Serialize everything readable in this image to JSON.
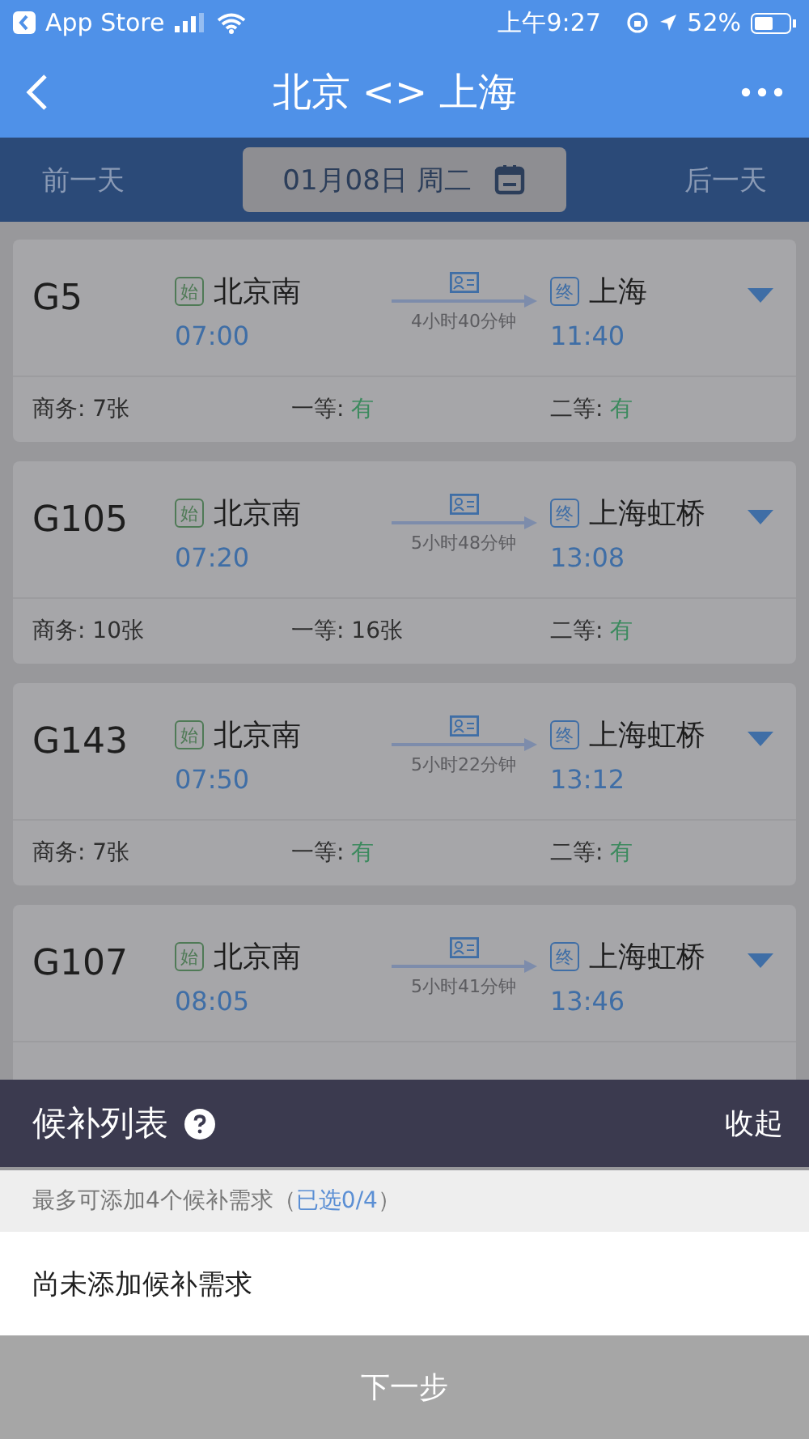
{
  "status_bar": {
    "back_app": "App Store",
    "time": "上午9:27",
    "battery": "52%"
  },
  "nav": {
    "title": "北京 <> 上海"
  },
  "date_bar": {
    "prev": "前一天",
    "date": "01月08日 周二",
    "next": "后一天"
  },
  "trains": [
    {
      "number": "G5",
      "start_badge": "始",
      "from": "北京南",
      "depart": "07:00",
      "duration": "4小时40分钟",
      "end_badge": "终",
      "to": "上海",
      "arrive": "11:40",
      "seats": [
        {
          "label": "商务:",
          "value": "7张",
          "available": false
        },
        {
          "label": "一等:",
          "value": "有",
          "available": true
        },
        {
          "label": "二等:",
          "value": "有",
          "available": true
        }
      ]
    },
    {
      "number": "G105",
      "start_badge": "始",
      "from": "北京南",
      "depart": "07:20",
      "duration": "5小时48分钟",
      "end_badge": "终",
      "to": "上海虹桥",
      "arrive": "13:08",
      "seats": [
        {
          "label": "商务:",
          "value": "10张",
          "available": false
        },
        {
          "label": "一等:",
          "value": "16张",
          "available": false
        },
        {
          "label": "二等:",
          "value": "有",
          "available": true
        }
      ]
    },
    {
      "number": "G143",
      "start_badge": "始",
      "from": "北京南",
      "depart": "07:50",
      "duration": "5小时22分钟",
      "end_badge": "终",
      "to": "上海虹桥",
      "arrive": "13:12",
      "seats": [
        {
          "label": "商务:",
          "value": "7张",
          "available": false
        },
        {
          "label": "一等:",
          "value": "有",
          "available": true
        },
        {
          "label": "二等:",
          "value": "有",
          "available": true
        }
      ]
    },
    {
      "number": "G107",
      "start_badge": "始",
      "from": "北京南",
      "depart": "08:05",
      "duration": "5小时41分钟",
      "end_badge": "终",
      "to": "上海虹桥",
      "arrive": "13:46"
    }
  ],
  "waitlist": {
    "title": "候补列表",
    "collapse": "收起",
    "hint": "最多可添加4个候补需求（",
    "selected_count": "已选0/4",
    "hint_end": "）",
    "empty": "尚未添加候补需求",
    "next_button": "下一步"
  }
}
